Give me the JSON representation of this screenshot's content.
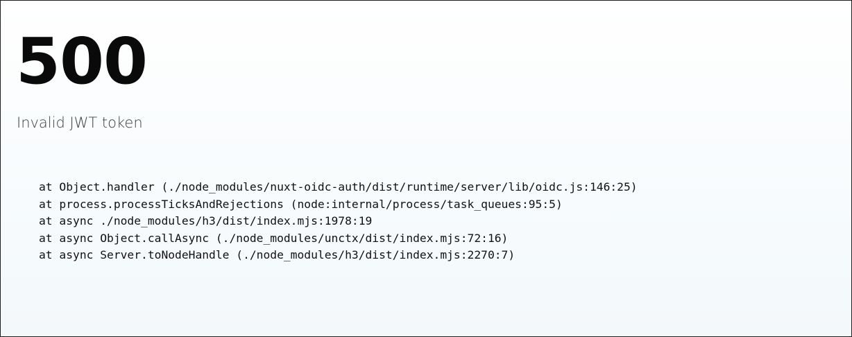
{
  "error": {
    "status_code": "500",
    "message": "Invalid JWT token"
  },
  "stack_trace": {
    "lines": [
      "at Object.handler (./node_modules/nuxt-oidc-auth/dist/runtime/server/lib/oidc.js:146:25)",
      "at process.processTicksAndRejections (node:internal/process/task_queues:95:5)",
      "at async ./node_modules/h3/dist/index.mjs:1978:19",
      "at async Object.callAsync (./node_modules/unctx/dist/index.mjs:72:16)",
      "at async Server.toNodeHandle (./node_modules/h3/dist/index.mjs:2270:7)"
    ]
  }
}
